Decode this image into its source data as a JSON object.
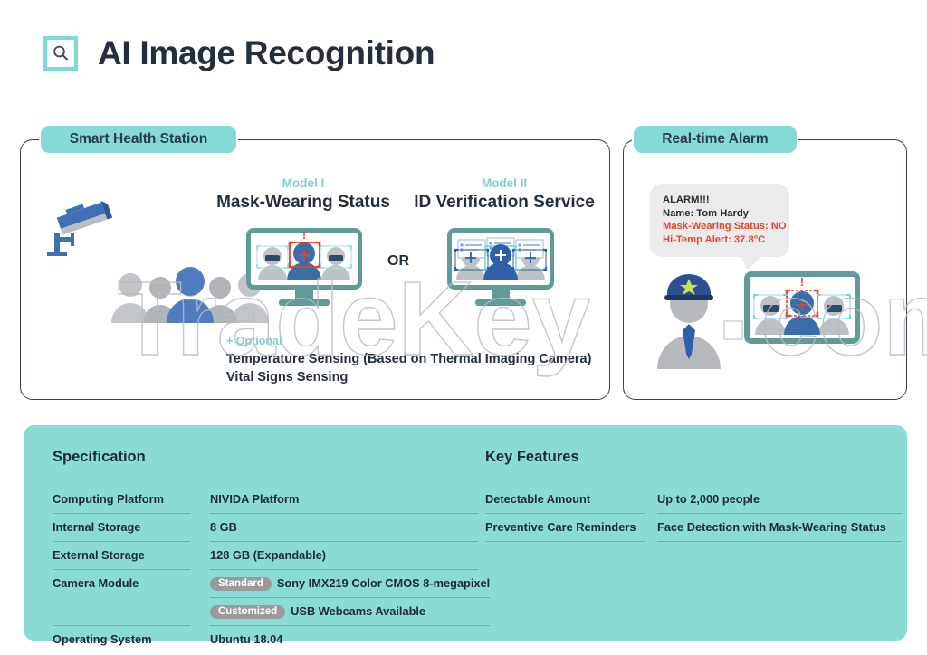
{
  "header": {
    "title": "AI Image Recognition",
    "logo_icon": "search-icon"
  },
  "panels": {
    "left_tab": "Smart Health Station",
    "right_tab": "Real-time Alarm"
  },
  "models": {
    "model1": {
      "kicker": "Model I",
      "title": "Mask-Wearing Status"
    },
    "or": "OR",
    "model2": {
      "kicker": "Model II",
      "title": "ID Verification Service"
    }
  },
  "optional": {
    "kicker": "+ Optional",
    "lines": [
      "Temperature Sensing (Based on Thermal Imaging Camera)",
      "Vital Signs Sensing"
    ]
  },
  "alarm": {
    "lines": [
      {
        "text": "ALARM!!!",
        "color": "#2b2b2b"
      },
      {
        "text": "Name: Tom Hardy",
        "color": "#2b2b2b"
      },
      {
        "text": "Mask-Wearing Status:  NO",
        "color": "#e8442a"
      },
      {
        "text": "Hi-Temp Alert: 37.8°C",
        "color": "#e8442a"
      }
    ]
  },
  "specification": {
    "heading": "Specification",
    "rows": [
      {
        "key": "Computing Platform",
        "value": "NIVIDA Platform"
      },
      {
        "key": "Internal Storage",
        "value": "8 GB"
      },
      {
        "key": "External Storage",
        "value": "128 GB  (Expandable)"
      },
      {
        "key": "Camera Module",
        "chip": "Standard",
        "value": "Sony IMX219 Color CMOS 8-megapixel"
      },
      {
        "key": "",
        "chip": "Customized",
        "value": "USB Webcams Available"
      },
      {
        "key": "Operating System",
        "value": "Ubuntu 18.04"
      }
    ]
  },
  "key_features": {
    "heading": "Key Features",
    "rows": [
      {
        "key": "Detectable Amount",
        "value": "Up to 2,000 people"
      },
      {
        "key": "Preventive Care Reminders",
        "value": "Face Detection with Mask-Wearing Status"
      }
    ]
  },
  "watermark": {
    "text": "TradeKey",
    "suffix": ".com"
  },
  "colors": {
    "teal": "#84dbd5",
    "teal_panel": "#8bdbd5",
    "dark": "#232f3e",
    "alert_red": "#e8442a",
    "monitor_border": "#5f9c99",
    "accent_blue": "#3f6fb5"
  }
}
